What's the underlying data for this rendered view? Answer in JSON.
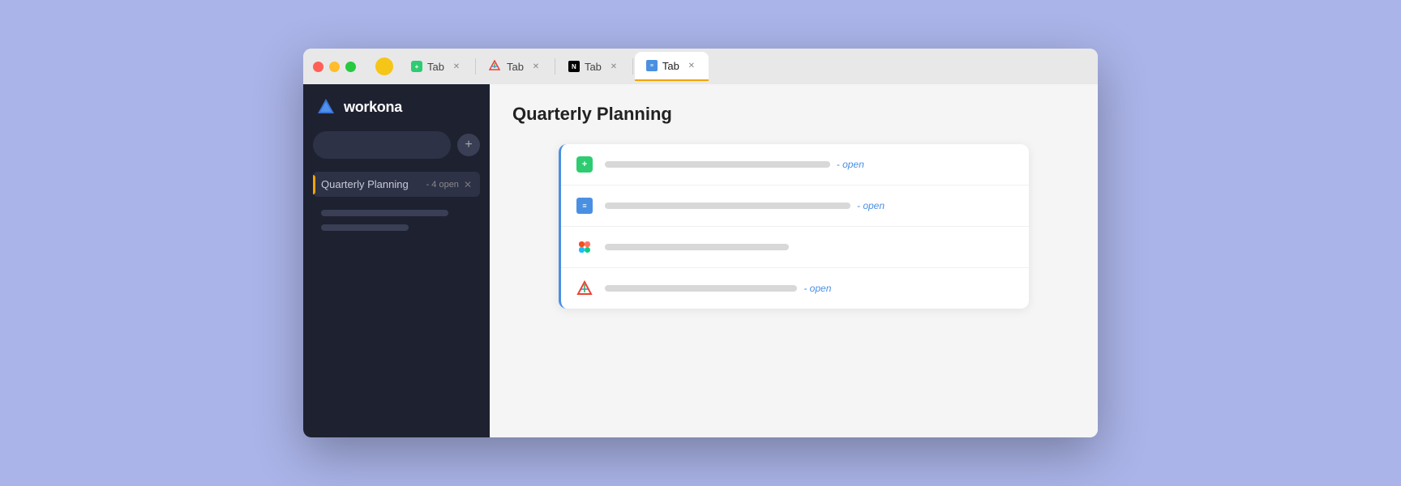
{
  "browser": {
    "tabs": [
      {
        "id": "tab1",
        "label": "Tab",
        "icon_type": "todo",
        "active": false
      },
      {
        "id": "tab2",
        "label": "Tab",
        "icon_type": "gsuite",
        "active": false
      },
      {
        "id": "tab3",
        "label": "Tab",
        "icon_type": "notion",
        "active": false
      },
      {
        "id": "tab4",
        "label": "Tab",
        "icon_type": "doc",
        "active": true
      }
    ]
  },
  "sidebar": {
    "logo_text": "workona",
    "search_placeholder": "",
    "workspace": {
      "name": "Quarterly Planning",
      "badge": "- 4 open"
    },
    "placeholder_lines": [
      {
        "width": "80%"
      },
      {
        "width": "55%"
      }
    ]
  },
  "main": {
    "title": "Quarterly Planning",
    "tab_list": [
      {
        "icon_type": "todo",
        "bar_width": "55%",
        "open_label": "- open",
        "has_open": true
      },
      {
        "icon_type": "doc",
        "bar_width": "60%",
        "open_label": "- open",
        "has_open": true
      },
      {
        "icon_type": "figma",
        "bar_width": "45%",
        "has_open": false
      },
      {
        "icon_type": "gsuite",
        "bar_width": "47%",
        "open_label": "- open",
        "has_open": true
      }
    ]
  },
  "colors": {
    "accent_orange": "#f0a500",
    "accent_blue": "#4a90e2",
    "sidebar_bg": "#1e2130"
  }
}
